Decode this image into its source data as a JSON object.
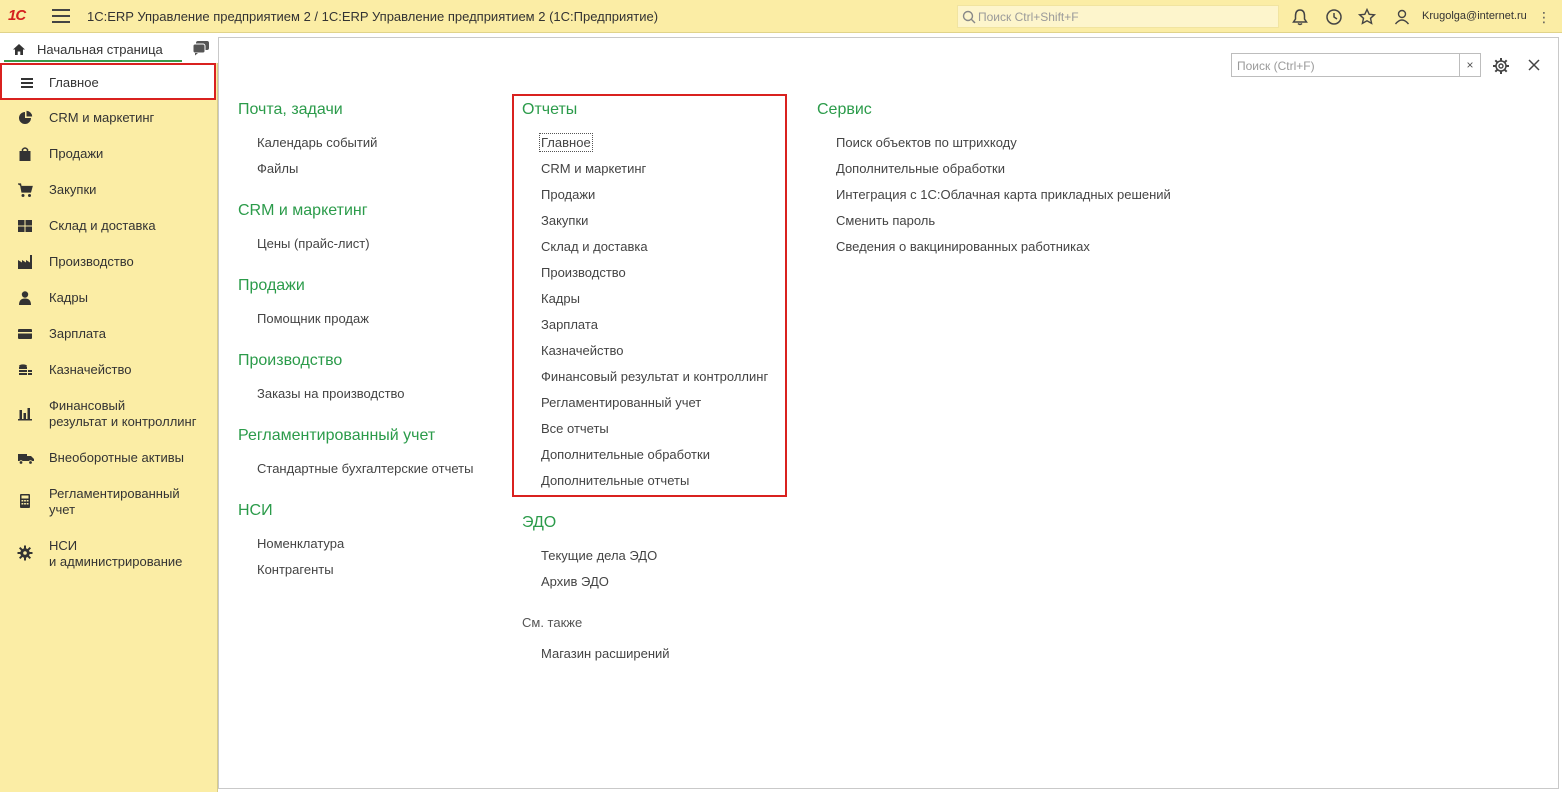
{
  "app": {
    "logo": "1С",
    "title": "1С:ERP Управление предприятием 2 / 1С:ERP Управление предприятием 2  (1С:Предприятие)",
    "search_placeholder": "Поиск Ctrl+Shift+F",
    "user": "Krugolga@internet.ru"
  },
  "tab": {
    "home_label": "Начальная страница"
  },
  "sidebar": {
    "items": [
      {
        "label": "Главное",
        "icon": "menu-lines-icon",
        "active": true
      },
      {
        "label": "CRM и маркетинг",
        "icon": "pie-chart-icon"
      },
      {
        "label": "Продажи",
        "icon": "shopping-bag-icon"
      },
      {
        "label": "Закупки",
        "icon": "cart-icon"
      },
      {
        "label": "Склад и доставка",
        "icon": "warehouse-grid-icon"
      },
      {
        "label": "Производство",
        "icon": "factory-icon"
      },
      {
        "label": "Кадры",
        "icon": "person-icon"
      },
      {
        "label": "Зарплата",
        "icon": "wallet-icon"
      },
      {
        "label": "Казначейство",
        "icon": "coins-icon"
      },
      {
        "label": "Финансовый\nрезультат и контроллинг",
        "line1": "Финансовый",
        "line2": "результат и контроллинг",
        "icon": "bar-chart-icon"
      },
      {
        "label": "Внеоборотные активы",
        "icon": "truck-icon"
      },
      {
        "label": "Регламентированный\nучет",
        "line1": "Регламентированный",
        "line2": "учет",
        "icon": "calculator-icon"
      },
      {
        "label": "НСИ\nи администрирование",
        "line1": "НСИ",
        "line2": "и администрирование",
        "icon": "gear-icon"
      }
    ]
  },
  "content": {
    "search_placeholder": "Поиск (Ctrl+F)",
    "clear_label": "×",
    "col1": {
      "mail": {
        "title": "Почта, задачи",
        "links": [
          "Календарь событий",
          "Файлы"
        ]
      },
      "crm": {
        "title": "CRM и маркетинг",
        "links": [
          "Цены (прайс-лист)"
        ]
      },
      "sales": {
        "title": "Продажи",
        "links": [
          "Помощник продаж"
        ]
      },
      "production": {
        "title": "Производство",
        "links": [
          "Заказы на производство"
        ]
      },
      "regulated": {
        "title": "Регламентированный учет",
        "links": [
          "Стандартные бухгалтерские отчеты"
        ]
      },
      "nsi": {
        "title": "НСИ",
        "links": [
          "Номенклатура",
          "Контрагенты"
        ]
      }
    },
    "col2": {
      "reports": {
        "title": "Отчеты",
        "links": [
          "Главное",
          "CRM и маркетинг",
          "Продажи",
          "Закупки",
          "Склад и доставка",
          "Производство",
          "Кадры",
          "Зарплата",
          "Казначейство",
          "Финансовый результат и контроллинг",
          "Регламентированный учет",
          "Все отчеты",
          "Дополнительные обработки",
          "Дополнительные отчеты"
        ]
      },
      "edo": {
        "title": "ЭДО",
        "links": [
          "Текущие дела ЭДО",
          "Архив ЭДО"
        ]
      },
      "see_also": {
        "title": "См. также",
        "links": [
          "Магазин расширений"
        ]
      }
    },
    "col3": {
      "service": {
        "title": "Сервис",
        "links": [
          "Поиск объектов по штрихкоду",
          "Дополнительные обработки",
          "Интеграция с 1С:Облачная карта прикладных решений",
          "Сменить пароль",
          "Сведения о вакцинированных работниках"
        ]
      }
    }
  },
  "colors": {
    "accent_green": "#2b9b4a",
    "highlight_red": "#d9211f",
    "panel_yellow": "#fbeda5"
  }
}
